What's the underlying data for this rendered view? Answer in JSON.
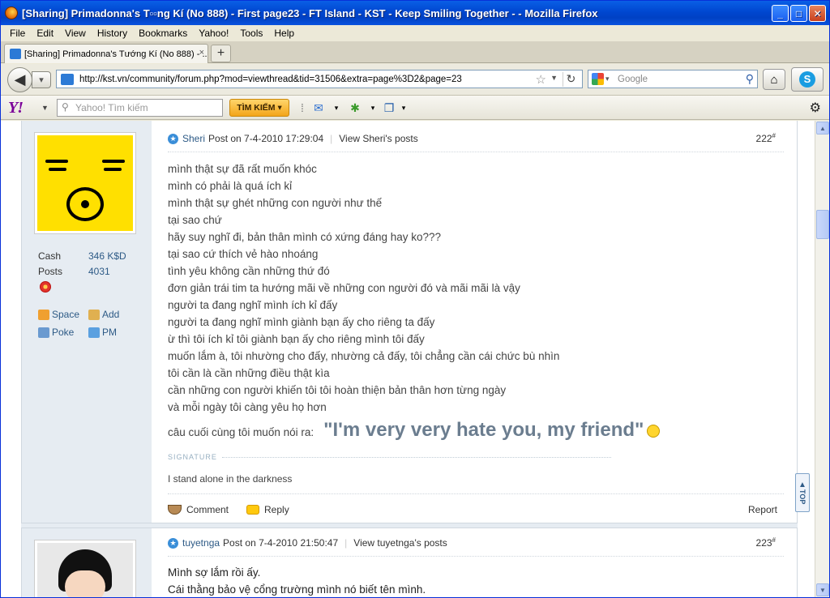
{
  "window": {
    "title": "[Sharing] Primadonna's T▫▫ng Kí (No 888) - First page23 - FT Island - KST - Keep Smiling Together - - Mozilla Firefox"
  },
  "menu": [
    "File",
    "Edit",
    "View",
    "History",
    "Bookmarks",
    "Yahoo!",
    "Tools",
    "Help"
  ],
  "tab": {
    "label": "[Sharing] Primadonna's Tướng Kí (No 888) - ...",
    "new_label": "+"
  },
  "nav": {
    "url": "http://kst.vn/community/forum.php?mod=viewthread&tid=31506&extra=page%3D2&page=23",
    "search_placeholder": "Google"
  },
  "yahoo": {
    "logo": "Y!",
    "search_placeholder": "Yahoo! Tìm kiếm",
    "search_button": "TÌM KIẾM ▾"
  },
  "posts": [
    {
      "author": "Sheri",
      "post_on": "Post on 7-4-2010 17:29:04",
      "view_posts": "View Sheri's posts",
      "number": "222",
      "stats": [
        {
          "k": "Cash",
          "v": "346 K$D"
        },
        {
          "k": "Posts",
          "v": "4031"
        }
      ],
      "links": [
        "Space",
        "Add",
        "Poke",
        "PM"
      ],
      "lines": [
        "mình thật sự đã rất muốn khóc",
        "mình có phải là quá ích kỉ",
        "mình thật sự ghét những con người như thế",
        "tại sao chứ",
        "hãy suy nghĩ đi, bản thân mình có xứng đáng hay ko???",
        "tại sao cứ thích vẻ hào nhoáng",
        "tình yêu không cần những thứ đó",
        "đơn giản trái tim ta hướng mãi về những con người đó và mãi mãi là vậy",
        "người ta đang nghĩ mình ích kỉ đấy",
        "người ta đang nghĩ mình giành bạn ấy cho riêng ta đấy",
        "ừ thì tôi ích kỉ tôi giành bạn ấy cho riêng mình tôi đấy",
        "muốn lắm à, tôi nhường cho đấy, nhường cả đấy, tôi chẳng cần cái chức bù nhìn",
        "tôi cần là cần những điều thật kìa",
        "cần những con người khiến tôi tôi hoàn thiện bản thân hơn từng ngày",
        "và mỗi ngày tôi càng yêu họ hơn"
      ],
      "last_line": "câu cuối cùng tôi muốn nói ra:",
      "big_quote": "\"I'm very very hate you, my friend\"",
      "signature_label": "SIGNATURE",
      "signature": "I stand alone in the darkness",
      "actions": {
        "comment": "Comment",
        "reply": "Reply",
        "report": "Report"
      }
    },
    {
      "author": "tuyetnga",
      "post_on": "Post on 7-4-2010 21:50:47",
      "view_posts": "View tuyetnga's posts",
      "number": "223",
      "lines": [
        "Mình sợ lắm rồi ấy.",
        "Cái thằng bảo vệ cổng trường mình nó biết tên mình."
      ]
    }
  ],
  "floating": {
    "label": "TOP"
  }
}
